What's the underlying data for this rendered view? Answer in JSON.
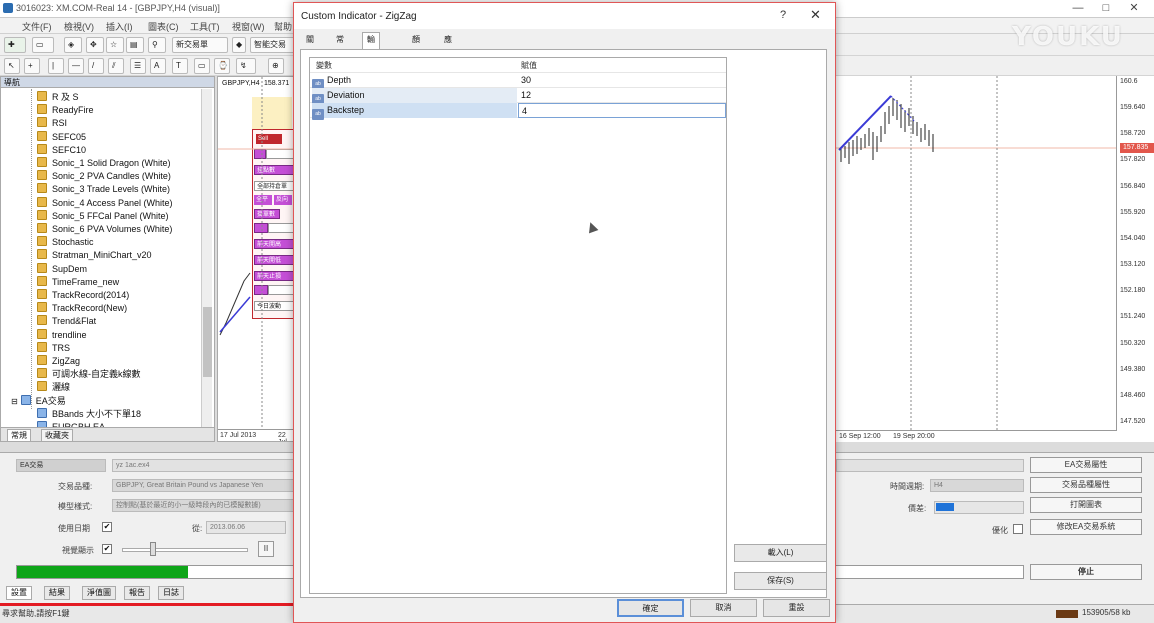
{
  "window": {
    "title": "3016023: XM.COM-Real 14 - [GBPJPY,H4 (visual)]",
    "controls": [
      "—",
      "□",
      "✕"
    ]
  },
  "menu": [
    "文件(F)",
    "檢視(V)",
    "插入(I)",
    "圖表(C)",
    "工具(T)",
    "視窗(W)",
    "幫助"
  ],
  "toolbar": {
    "new_order": "新交易單",
    "auto_trading": "智能交易"
  },
  "navigator": {
    "header": "導航",
    "indicators": [
      "R 及 S",
      "ReadyFire",
      "RSI",
      "SEFC05",
      "SEFC10",
      "Sonic_1 Solid Dragon (White)",
      "Sonic_2 PVA Candles (White)",
      "Sonic_3 Trade Levels (White)",
      "Sonic_4 Access Panel (White)",
      "Sonic_5 FFCal Panel (White)",
      "Sonic_6 PVA Volumes (White)",
      "Stochastic",
      "Stratman_MiniChart_v20",
      "SupDem",
      "TimeFrame_new",
      "TrackRecord(2014)",
      "TrackRecord(New)",
      "Trend&Flat",
      "trendline",
      "TRS",
      "ZigZag",
      "可調水線-自定義k線數",
      "灑線"
    ],
    "ea_group": "EA交易",
    "ea_items": [
      "BBands 大小不下單18",
      "EURGBH EA"
    ],
    "tabs": [
      "常規",
      "收藏夾"
    ]
  },
  "chart": {
    "symbol_label": "GBPJPY,H4",
    "price_label": "158.371",
    "left_dates": [
      "17 Jul 2013",
      "22 Jul"
    ],
    "right_dates": [
      "16 Sep 12:00",
      "19 Sep 20:00"
    ],
    "price_ticks": [
      "160.6",
      "159.640",
      "158.720",
      "157.820",
      "156.840",
      "155.920",
      "154.040",
      "153.120",
      "152.180",
      "151.240",
      "150.320",
      "149.380",
      "148.460",
      "147.520"
    ],
    "current_price": "157.835",
    "panel": {
      "sell": "Sell",
      "buttons": [
        "全部持倉單",
        "全平",
        "反向",
        "掛單數",
        "前天開高",
        "前天開低",
        "前天止損",
        "今日波動"
      ],
      "checkbox_label": "挂點數"
    }
  },
  "dialog": {
    "title": "Custom Indicator - ZigZag",
    "help": "?",
    "close": "✕",
    "tabs": [
      "關於",
      "常規",
      "輸入參數",
      "顏色",
      "應用範圍"
    ],
    "active_tab": "輸入參數",
    "columns": [
      "變數",
      "賦值"
    ],
    "params": [
      {
        "name": "Depth",
        "value": "30",
        "icon": "ab"
      },
      {
        "name": "Deviation",
        "value": "12",
        "icon": "ab"
      },
      {
        "name": "Backstep",
        "value": "4",
        "icon": "ab"
      }
    ],
    "side_buttons": [
      "載入(L)",
      "保存(S)"
    ],
    "footer_buttons": [
      "確定",
      "取消",
      "重設"
    ]
  },
  "tester": {
    "ea_label": "EA交易",
    "ea_value": "yz 1ac.ex4",
    "symbol_label": "交易品種:",
    "symbol_value": "GBPJPY, Great Britain Pound vs Japanese Yen",
    "model_label": "模型樣式:",
    "model_value": "控制點(基於最近的小一級時段內的已模擬數據)",
    "use_date_label": "使用日期",
    "from_label": "從:",
    "from_value": "2013.06.06",
    "visual_label": "視覺顯示",
    "pause": "II",
    "period_label": "時間週期:",
    "period_value": "H4",
    "spread_label": "價差:",
    "optimize_label": "優化",
    "buttons": [
      "EA交易屬性",
      "交易品種屬性",
      "打開圖表",
      "修改EA交易系統"
    ],
    "stop": "停止",
    "progress": 0.17,
    "tabs": [
      "設置",
      "結果",
      "淨值圖",
      "報告",
      "日誌"
    ]
  },
  "status": {
    "help": "尋求幫助,請按F1鍵",
    "traffic": "153905/58 kb",
    "video_progress": 0.435
  },
  "watermark": "YOUKU",
  "colors": {
    "accent_red": "#e31b23",
    "progress_green": "#0ea518",
    "zigzag_blue": "#3b3bd6"
  }
}
